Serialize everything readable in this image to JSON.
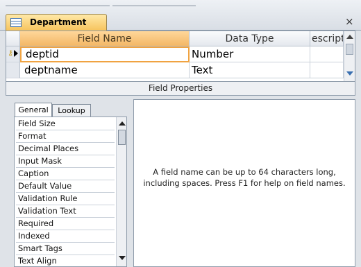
{
  "document_tab": {
    "title": "Department",
    "close_label": "×"
  },
  "grid": {
    "headers": {
      "field_name": "Field Name",
      "data_type": "Data Type",
      "description": "escripti"
    },
    "rows": [
      {
        "field_name": "deptid",
        "data_type": "Number",
        "description": "",
        "primary_key": true,
        "selected": true
      },
      {
        "field_name": "deptname",
        "data_type": "Text",
        "description": ""
      }
    ]
  },
  "field_properties": {
    "title": "Field Properties",
    "tabs": [
      {
        "label": "General",
        "active": true
      },
      {
        "label": "Lookup",
        "active": false
      }
    ],
    "properties": [
      "Field Size",
      "Format",
      "Decimal Places",
      "Input Mask",
      "Caption",
      "Default Value",
      "Validation Rule",
      "Validation Text",
      "Required",
      "Indexed",
      "Smart Tags",
      "Text Align"
    ],
    "help_text": "A field name can be up to 64 characters long, including spaces. Press F1 for help on field names."
  },
  "colors": {
    "active_tab": "#f6c25a",
    "selected_header": "#f3b766",
    "active_cell_border": "#f0a341",
    "chrome": "#dfe3e8"
  }
}
